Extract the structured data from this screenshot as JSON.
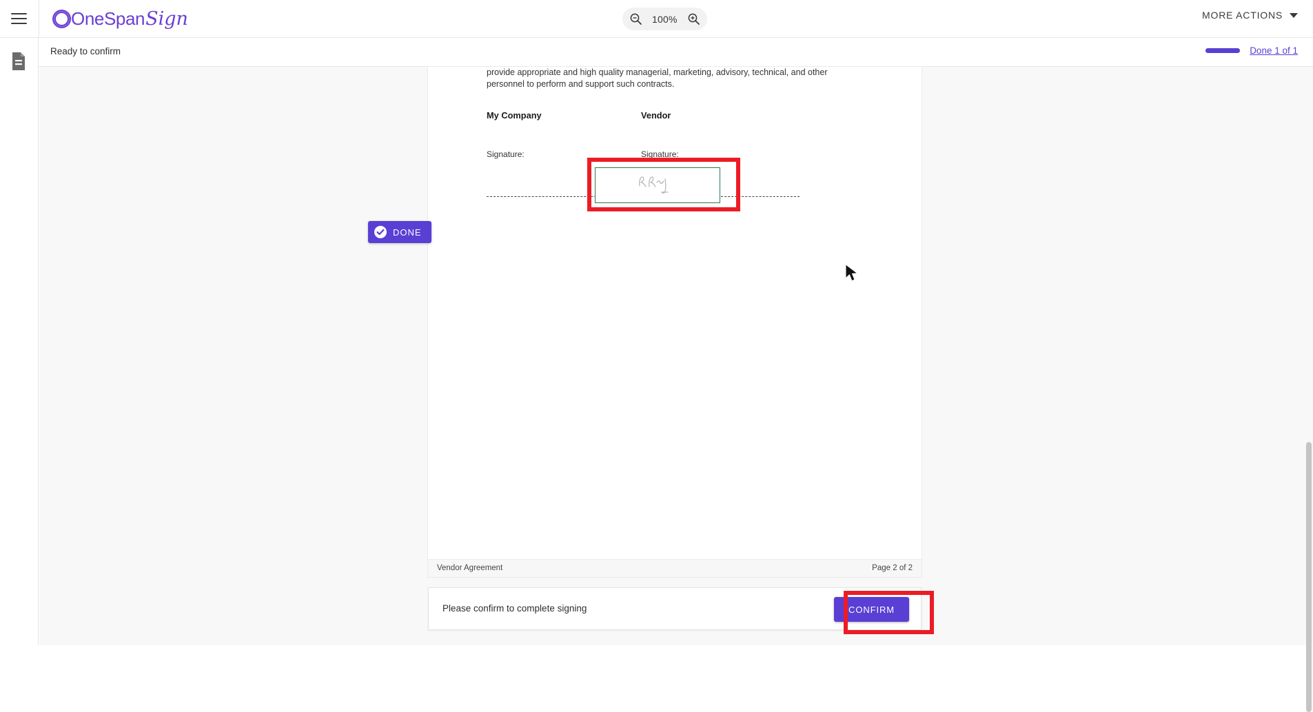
{
  "header": {
    "menu_icon": "hamburger-icon",
    "brand_name": "OneSpan",
    "brand_script": "Sign",
    "brand_color": "#6a3fd4",
    "zoom": {
      "out_icon": "zoom-out-icon",
      "level": "100%",
      "in_icon": "zoom-in-icon"
    },
    "more_actions": {
      "label": "MORE ACTIONS",
      "chevron_icon": "chevron-down-icon"
    }
  },
  "statusbar": {
    "status": "Ready to confirm",
    "progress_percent": 100,
    "done_link": "Done 1 of 1",
    "accent_color": "#5a3fd4"
  },
  "leftrail": {
    "document_icon": "document-page-icon"
  },
  "document": {
    "paragraph": "provide appropriate and high quality managerial, marketing, advisory, technical, and other personnel to perform and support such contracts.",
    "columns": [
      {
        "heading": "My Company",
        "signature_label": "Signature:"
      },
      {
        "heading": "Vendor",
        "signature_label": "Signature:"
      }
    ],
    "footer_left": "Vendor Agreement",
    "footer_right": "Page 2 of 2"
  },
  "signature_field": {
    "state_badge": "DONE",
    "badge_icon": "check-circle-icon",
    "border_color": "#2b7a4b",
    "ink_present": true
  },
  "annotations": {
    "highlight_color": "#ec1c24",
    "count": 2
  },
  "confirm_bar": {
    "message": "Please confirm to complete signing",
    "button_label": "CONFIRM"
  }
}
